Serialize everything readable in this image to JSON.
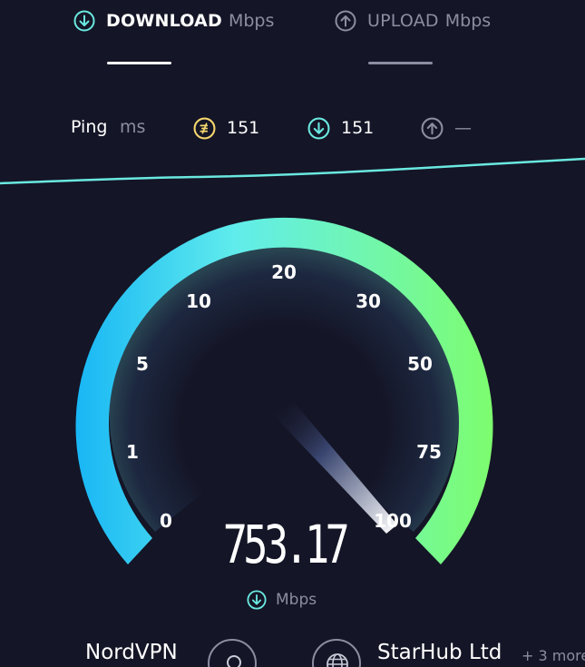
{
  "header": {
    "download": {
      "title": "DOWNLOAD",
      "unit": "Mbps"
    },
    "upload": {
      "title": "UPLOAD",
      "unit": "Mbps"
    }
  },
  "ping": {
    "label": "Ping",
    "unit": "ms",
    "jitter_value": "151",
    "download_value": "151",
    "upload_value": "—"
  },
  "gauge": {
    "labels": [
      "0",
      "1",
      "5",
      "10",
      "20",
      "30",
      "50",
      "75",
      "100"
    ],
    "speed_value": "753.17",
    "speed_unit": "Mbps"
  },
  "footer": {
    "provider": "NordVPN",
    "server": "StarHub Ltd",
    "server_more": "+ 3 more"
  },
  "colors": {
    "background": "#141526",
    "accent_cyan": "#6ae8e0",
    "accent_green": "#7dfd7a",
    "ping_yellow": "#f5d76e",
    "muted": "#8c8da1"
  }
}
